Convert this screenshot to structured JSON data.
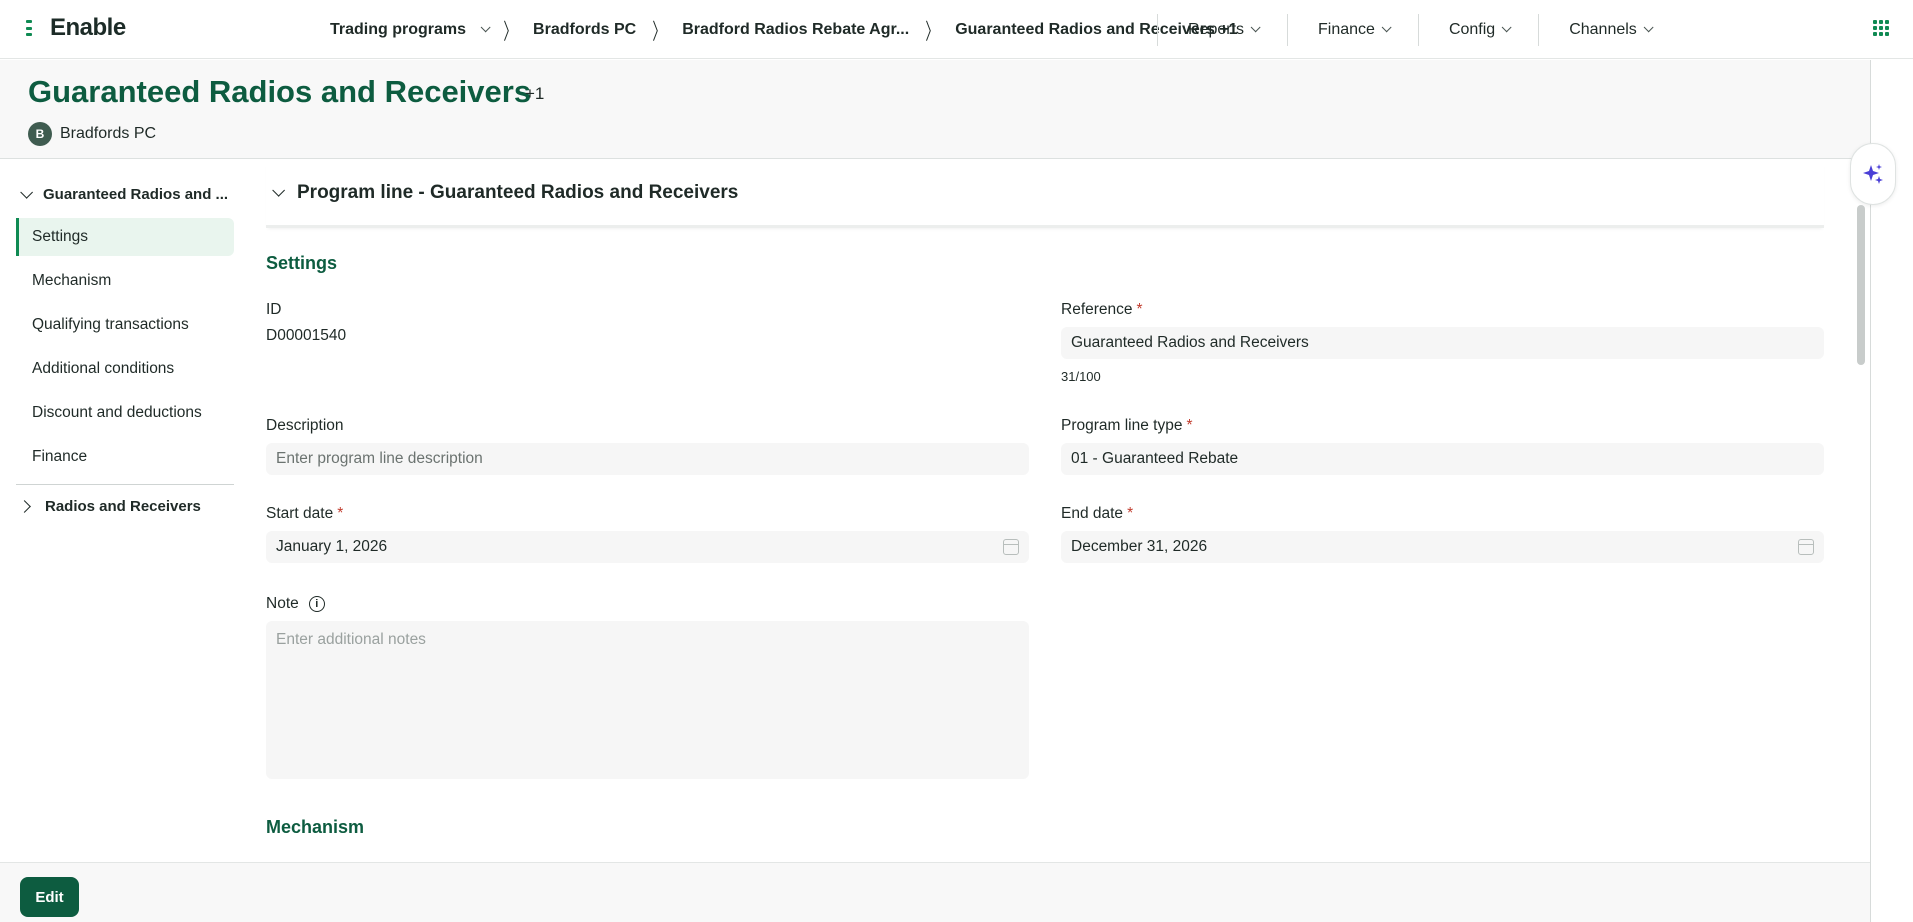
{
  "app": {
    "logo": "Enable"
  },
  "breadcrumb": {
    "items": [
      "Trading programs",
      "Bradfords PC",
      "Bradford Radios Rebate Agr...",
      "Guaranteed Radios and Receivers +1"
    ]
  },
  "topnav": {
    "items": [
      "Reports",
      "Finance",
      "Config",
      "Channels"
    ]
  },
  "header": {
    "title": "Guaranteed Radios and Receivers",
    "title_count": "+1",
    "owner_initial": "B",
    "owner_name": "Bradfords PC"
  },
  "sidebar": {
    "group1": "Guaranteed Radios and ...",
    "items": [
      "Settings",
      "Mechanism",
      "Qualifying transactions",
      "Additional conditions",
      "Discount and deductions",
      "Finance"
    ],
    "active_index": 0,
    "group2": "Radios and Receivers"
  },
  "main": {
    "section_title": "Program line - Guaranteed Radios and Receivers",
    "settings_title": "Settings",
    "id_label": "ID",
    "id_value": "D00001540",
    "reference_label": "Reference",
    "reference_value": "Guaranteed Radios and Receivers",
    "reference_counter": "31/100",
    "description_label": "Description",
    "description_placeholder": "Enter program line description",
    "type_label": "Program line type",
    "type_value": "01 - Guaranteed Rebate",
    "start_label": "Start date",
    "start_value": "January 1, 2026",
    "end_label": "End date",
    "end_value": "December 31, 2026",
    "note_label": "Note",
    "note_placeholder": "Enter additional notes",
    "mechanism_title": "Mechanism",
    "required_mark": "*",
    "info_glyph": "i"
  },
  "footer": {
    "edit_label": "Edit"
  },
  "colors": {
    "brand": "#0d5c40",
    "accent": "#0f8a53",
    "active_bg": "#e9f5ee",
    "required": "#c0392b"
  },
  "icons": [
    "apps-grid-icon",
    "sparkle-icon",
    "calendar-icon",
    "info-icon",
    "chevron-down-icon",
    "chevron-right-icon"
  ]
}
